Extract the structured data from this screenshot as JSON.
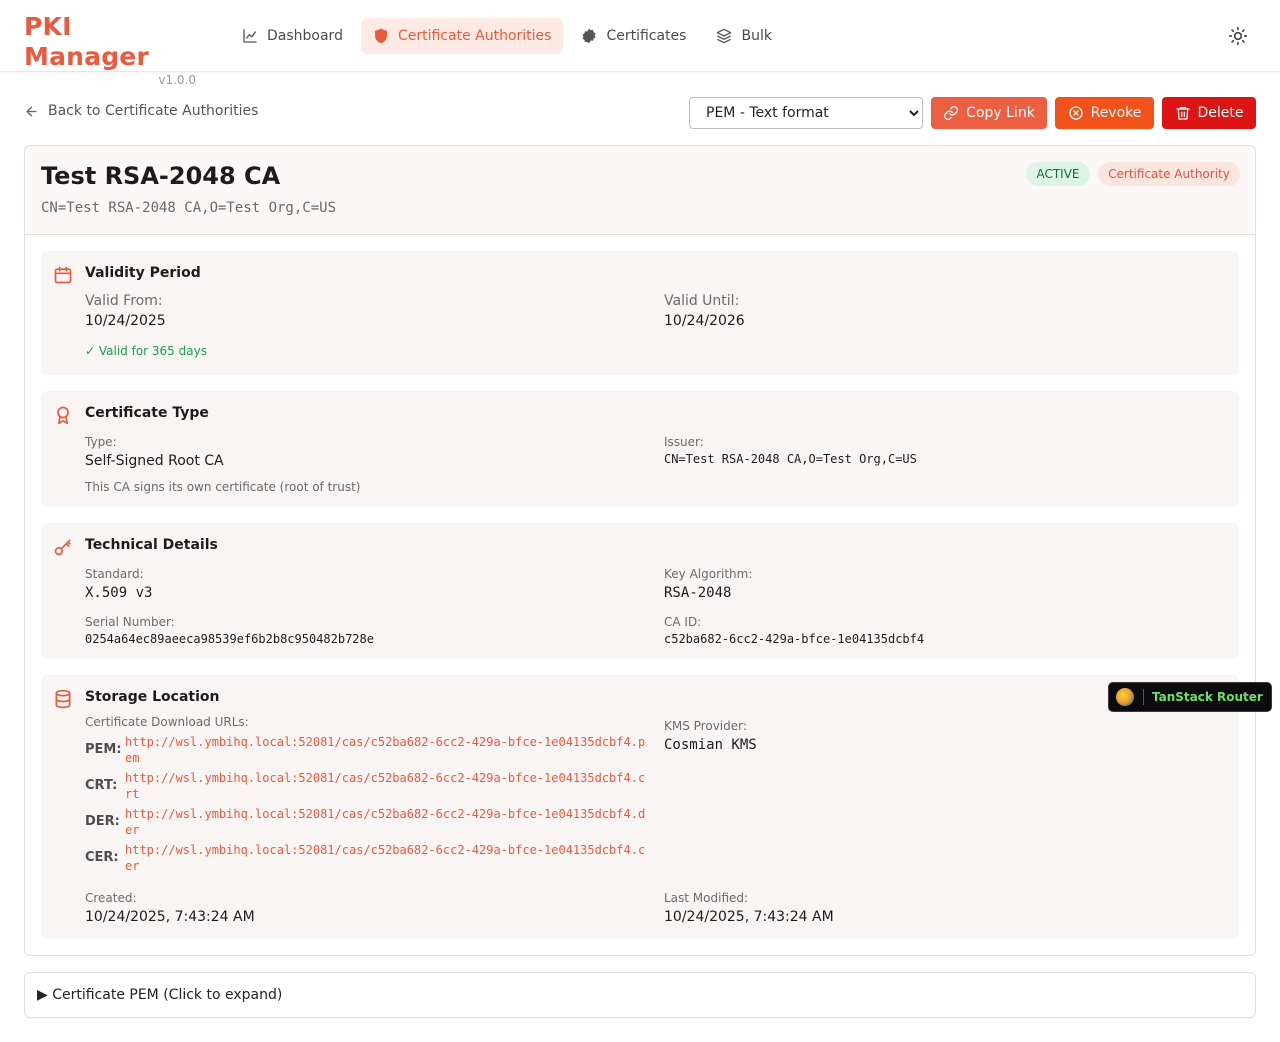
{
  "app": {
    "title": "PKI Manager",
    "version": "v1.0.0"
  },
  "nav": [
    {
      "label": "Dashboard",
      "icon": "chart-line-icon"
    },
    {
      "label": "Certificate Authorities",
      "icon": "shield-icon",
      "active": true
    },
    {
      "label": "Certificates",
      "icon": "badge-check-icon"
    },
    {
      "label": "Bulk",
      "icon": "layers-icon"
    }
  ],
  "toolbar": {
    "back_label": "Back to Certificate Authorities",
    "format_selected": "PEM - Text format",
    "copy_label": "Copy Link",
    "revoke_label": "Revoke",
    "delete_label": "Delete"
  },
  "ca": {
    "title": "Test RSA-2048 CA",
    "dn": "CN=Test RSA-2048 CA,O=Test Org,C=US",
    "status_badge": "ACTIVE",
    "type_badge": "Certificate Authority"
  },
  "validity": {
    "title": "Validity Period",
    "from_label": "Valid From:",
    "from_value": "10/24/2025",
    "until_label": "Valid Until:",
    "until_value": "10/24/2026",
    "remaining": "✓ Valid for 365 days"
  },
  "cert_type": {
    "title": "Certificate Type",
    "type_label": "Type:",
    "type_value": "Self-Signed Root CA",
    "type_note": "This CA signs its own certificate (root of trust)",
    "issuer_label": "Issuer:",
    "issuer_value": "CN=Test RSA-2048 CA,O=Test Org,C=US"
  },
  "technical": {
    "title": "Technical Details",
    "standard_label": "Standard:",
    "standard_value": "X.509 v3",
    "algo_label": "Key Algorithm:",
    "algo_value": "RSA-2048",
    "serial_label": "Serial Number:",
    "serial_value": "0254a64ec89aeeca98539ef6b2b8c950482b728e",
    "caid_label": "CA ID:",
    "caid_value": "c52ba682-6cc2-429a-bfce-1e04135dcbf4"
  },
  "storage": {
    "title": "Storage Location",
    "urls_label": "Certificate Download URLs:",
    "urls": [
      {
        "key": "PEM:",
        "url": "http://wsl.ymbihq.local:52081/cas/c52ba682-6cc2-429a-bfce-1e04135dcbf4.pem"
      },
      {
        "key": "CRT:",
        "url": "http://wsl.ymbihq.local:52081/cas/c52ba682-6cc2-429a-bfce-1e04135dcbf4.crt"
      },
      {
        "key": "DER:",
        "url": "http://wsl.ymbihq.local:52081/cas/c52ba682-6cc2-429a-bfce-1e04135dcbf4.der"
      },
      {
        "key": "CER:",
        "url": "http://wsl.ymbihq.local:52081/cas/c52ba682-6cc2-429a-bfce-1e04135dcbf4.cer"
      }
    ],
    "kms_label": "KMS Provider:",
    "kms_value": "Cosmian KMS",
    "created_label": "Created:",
    "created_value": "10/24/2025, 7:43:24 AM",
    "modified_label": "Last Modified:",
    "modified_value": "10/24/2025, 7:43:24 AM"
  },
  "pem": {
    "summary": "▶ Certificate PEM (Click to expand)"
  },
  "devtools": {
    "label": "TanStack Router"
  },
  "colors": {
    "accent": "#ec5a3e",
    "danger": "#dd1414",
    "warn": "#f2511b",
    "success": "#18a04a"
  }
}
